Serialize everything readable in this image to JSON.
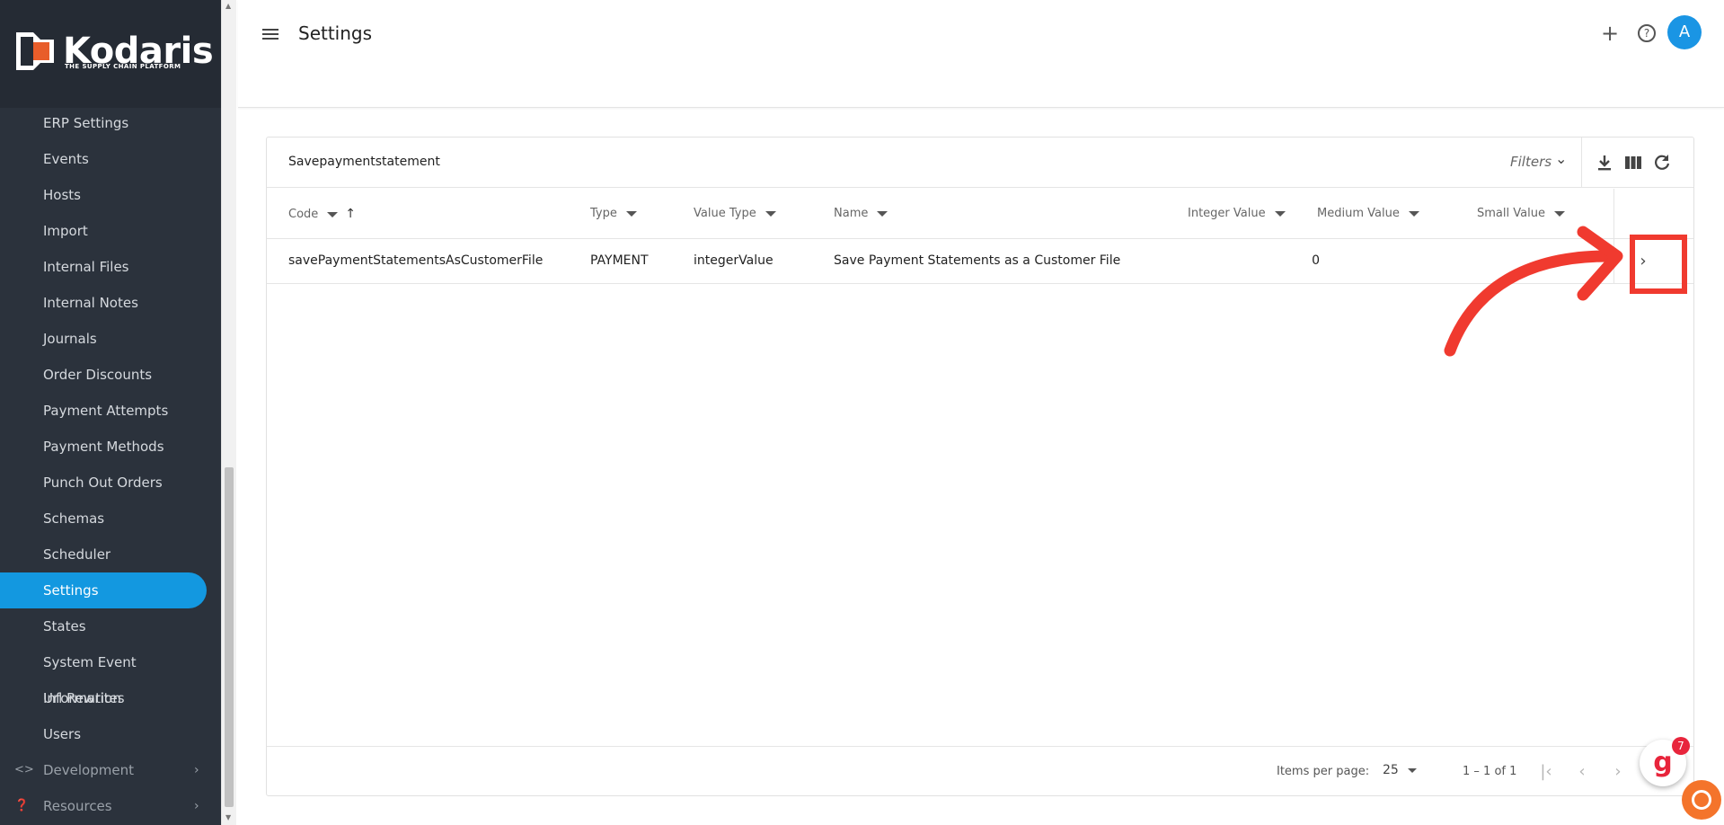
{
  "brand": {
    "name": "Kodaris",
    "tagline": "THE SUPPLY CHAIN PLATFORM",
    "accent": "#1398e0",
    "logo_color": "#e85d2a"
  },
  "sidebar": {
    "items": [
      {
        "label": "ERP Settings"
      },
      {
        "label": "Events"
      },
      {
        "label": "Hosts"
      },
      {
        "label": "Import"
      },
      {
        "label": "Internal Files"
      },
      {
        "label": "Internal Notes"
      },
      {
        "label": "Journals"
      },
      {
        "label": "Order Discounts"
      },
      {
        "label": "Payment Attempts"
      },
      {
        "label": "Payment Methods"
      },
      {
        "label": "Punch Out Orders"
      },
      {
        "label": "Schemas"
      },
      {
        "label": "Scheduler"
      },
      {
        "label": "Settings",
        "active": true
      },
      {
        "label": "States"
      },
      {
        "label": "System Event Information"
      },
      {
        "label": "Url Rewrites"
      },
      {
        "label": "Users"
      }
    ],
    "sections": [
      {
        "label": "Development",
        "icon": "code-icon"
      },
      {
        "label": "Resources",
        "icon": "help-circle-icon"
      }
    ]
  },
  "header": {
    "title": "Settings",
    "add_icon": "plus-icon",
    "help_icon": "help-icon",
    "avatar_initial": "A"
  },
  "toolbar": {
    "search_value": "Savepaymentstatement",
    "filters_label": "Filters"
  },
  "table": {
    "columns": [
      "Code",
      "Type",
      "Value Type",
      "Name",
      "Integer Value",
      "Medium Value",
      "Small Value"
    ],
    "rows": [
      {
        "code": "savePaymentStatementsAsCustomerFile",
        "type": "PAYMENT",
        "value_type": "integerValue",
        "name": "Save Payment Statements as a Customer File",
        "integer_value": "0",
        "medium_value": "",
        "small_value": ""
      }
    ]
  },
  "pagination": {
    "items_per_page_label": "Items per page:",
    "items_per_page": "25",
    "range": "1 – 1 of 1"
  },
  "widgets": {
    "g_badge_count": "7",
    "g_letter": "g"
  },
  "annotation_color": "#f03a2f"
}
